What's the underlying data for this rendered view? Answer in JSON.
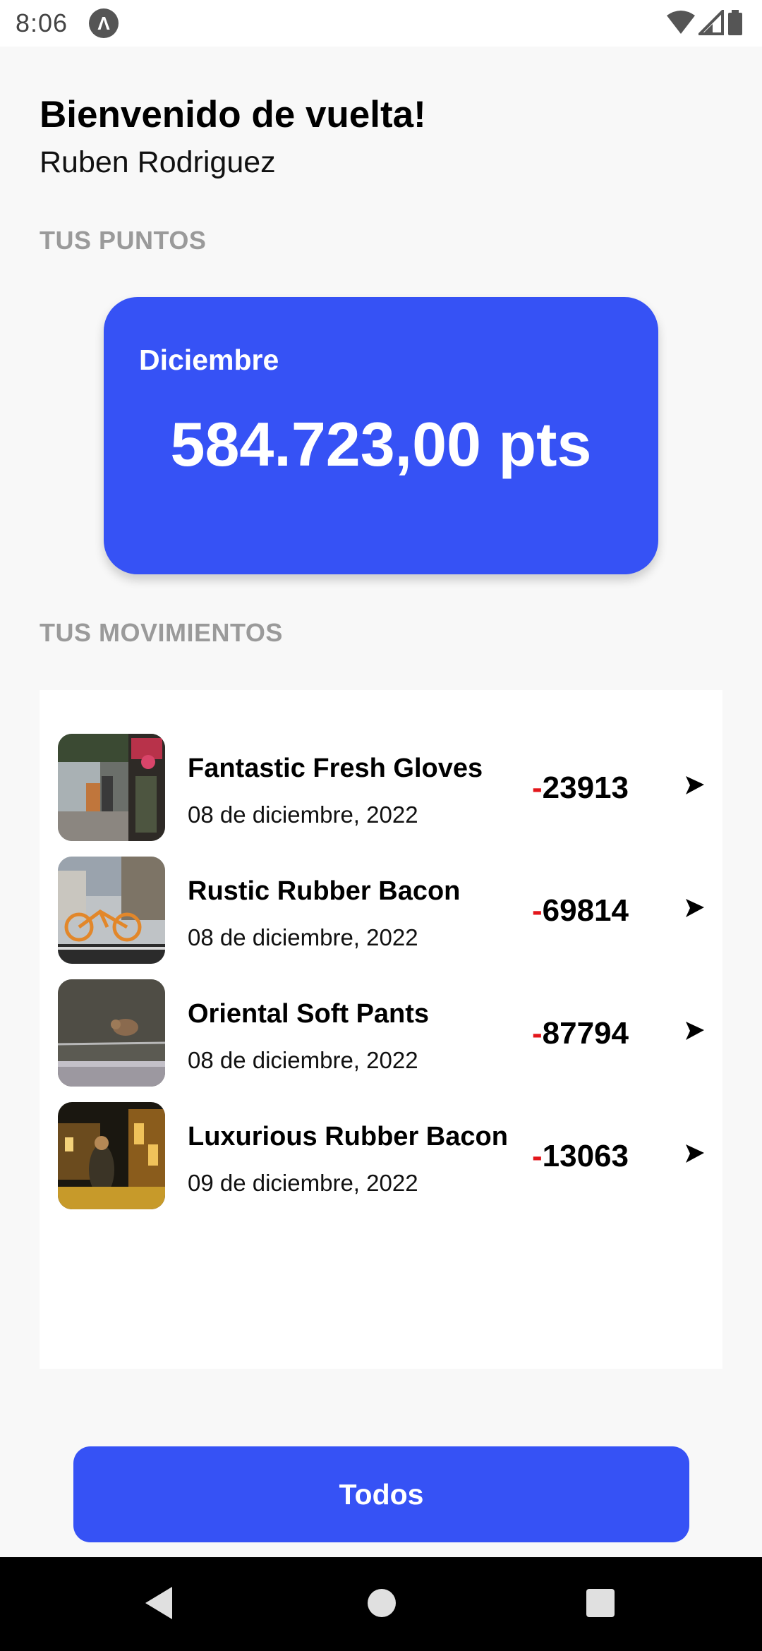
{
  "status_bar": {
    "time": "8:06",
    "app_icon_letter": "Λ"
  },
  "greeting": {
    "title": "Bienvenido de vuelta!",
    "name": "Ruben Rodriguez"
  },
  "points": {
    "section_label": "TUS PUNTOS",
    "month": "Diciembre",
    "value": "584.723,00 pts"
  },
  "movements": {
    "section_label": "TUS MOVIMIENTOS",
    "items": [
      {
        "name": "Fantastic Fresh Gloves",
        "date": "08 de diciembre, 2022",
        "sign": "-",
        "amount": "23913",
        "thumb": "cafe-street-photo"
      },
      {
        "name": "Rustic Rubber Bacon",
        "date": "08 de diciembre, 2022",
        "sign": "-",
        "amount": "69814",
        "thumb": "orange-bicycle-photo"
      },
      {
        "name": "Oriental Soft Pants",
        "date": "08 de diciembre, 2022",
        "sign": "-",
        "amount": "87794",
        "thumb": "bird-on-wire-photo"
      },
      {
        "name": "Luxurious Rubber Bacon",
        "date": "09 de diciembre, 2022",
        "sign": "-",
        "amount": "13063",
        "thumb": "night-street-photo"
      }
    ]
  },
  "actions": {
    "all_label": "Todos"
  },
  "colors": {
    "accent": "#3652f5",
    "negative_sign": "#e3161b",
    "section_label": "#9a9a9a"
  }
}
